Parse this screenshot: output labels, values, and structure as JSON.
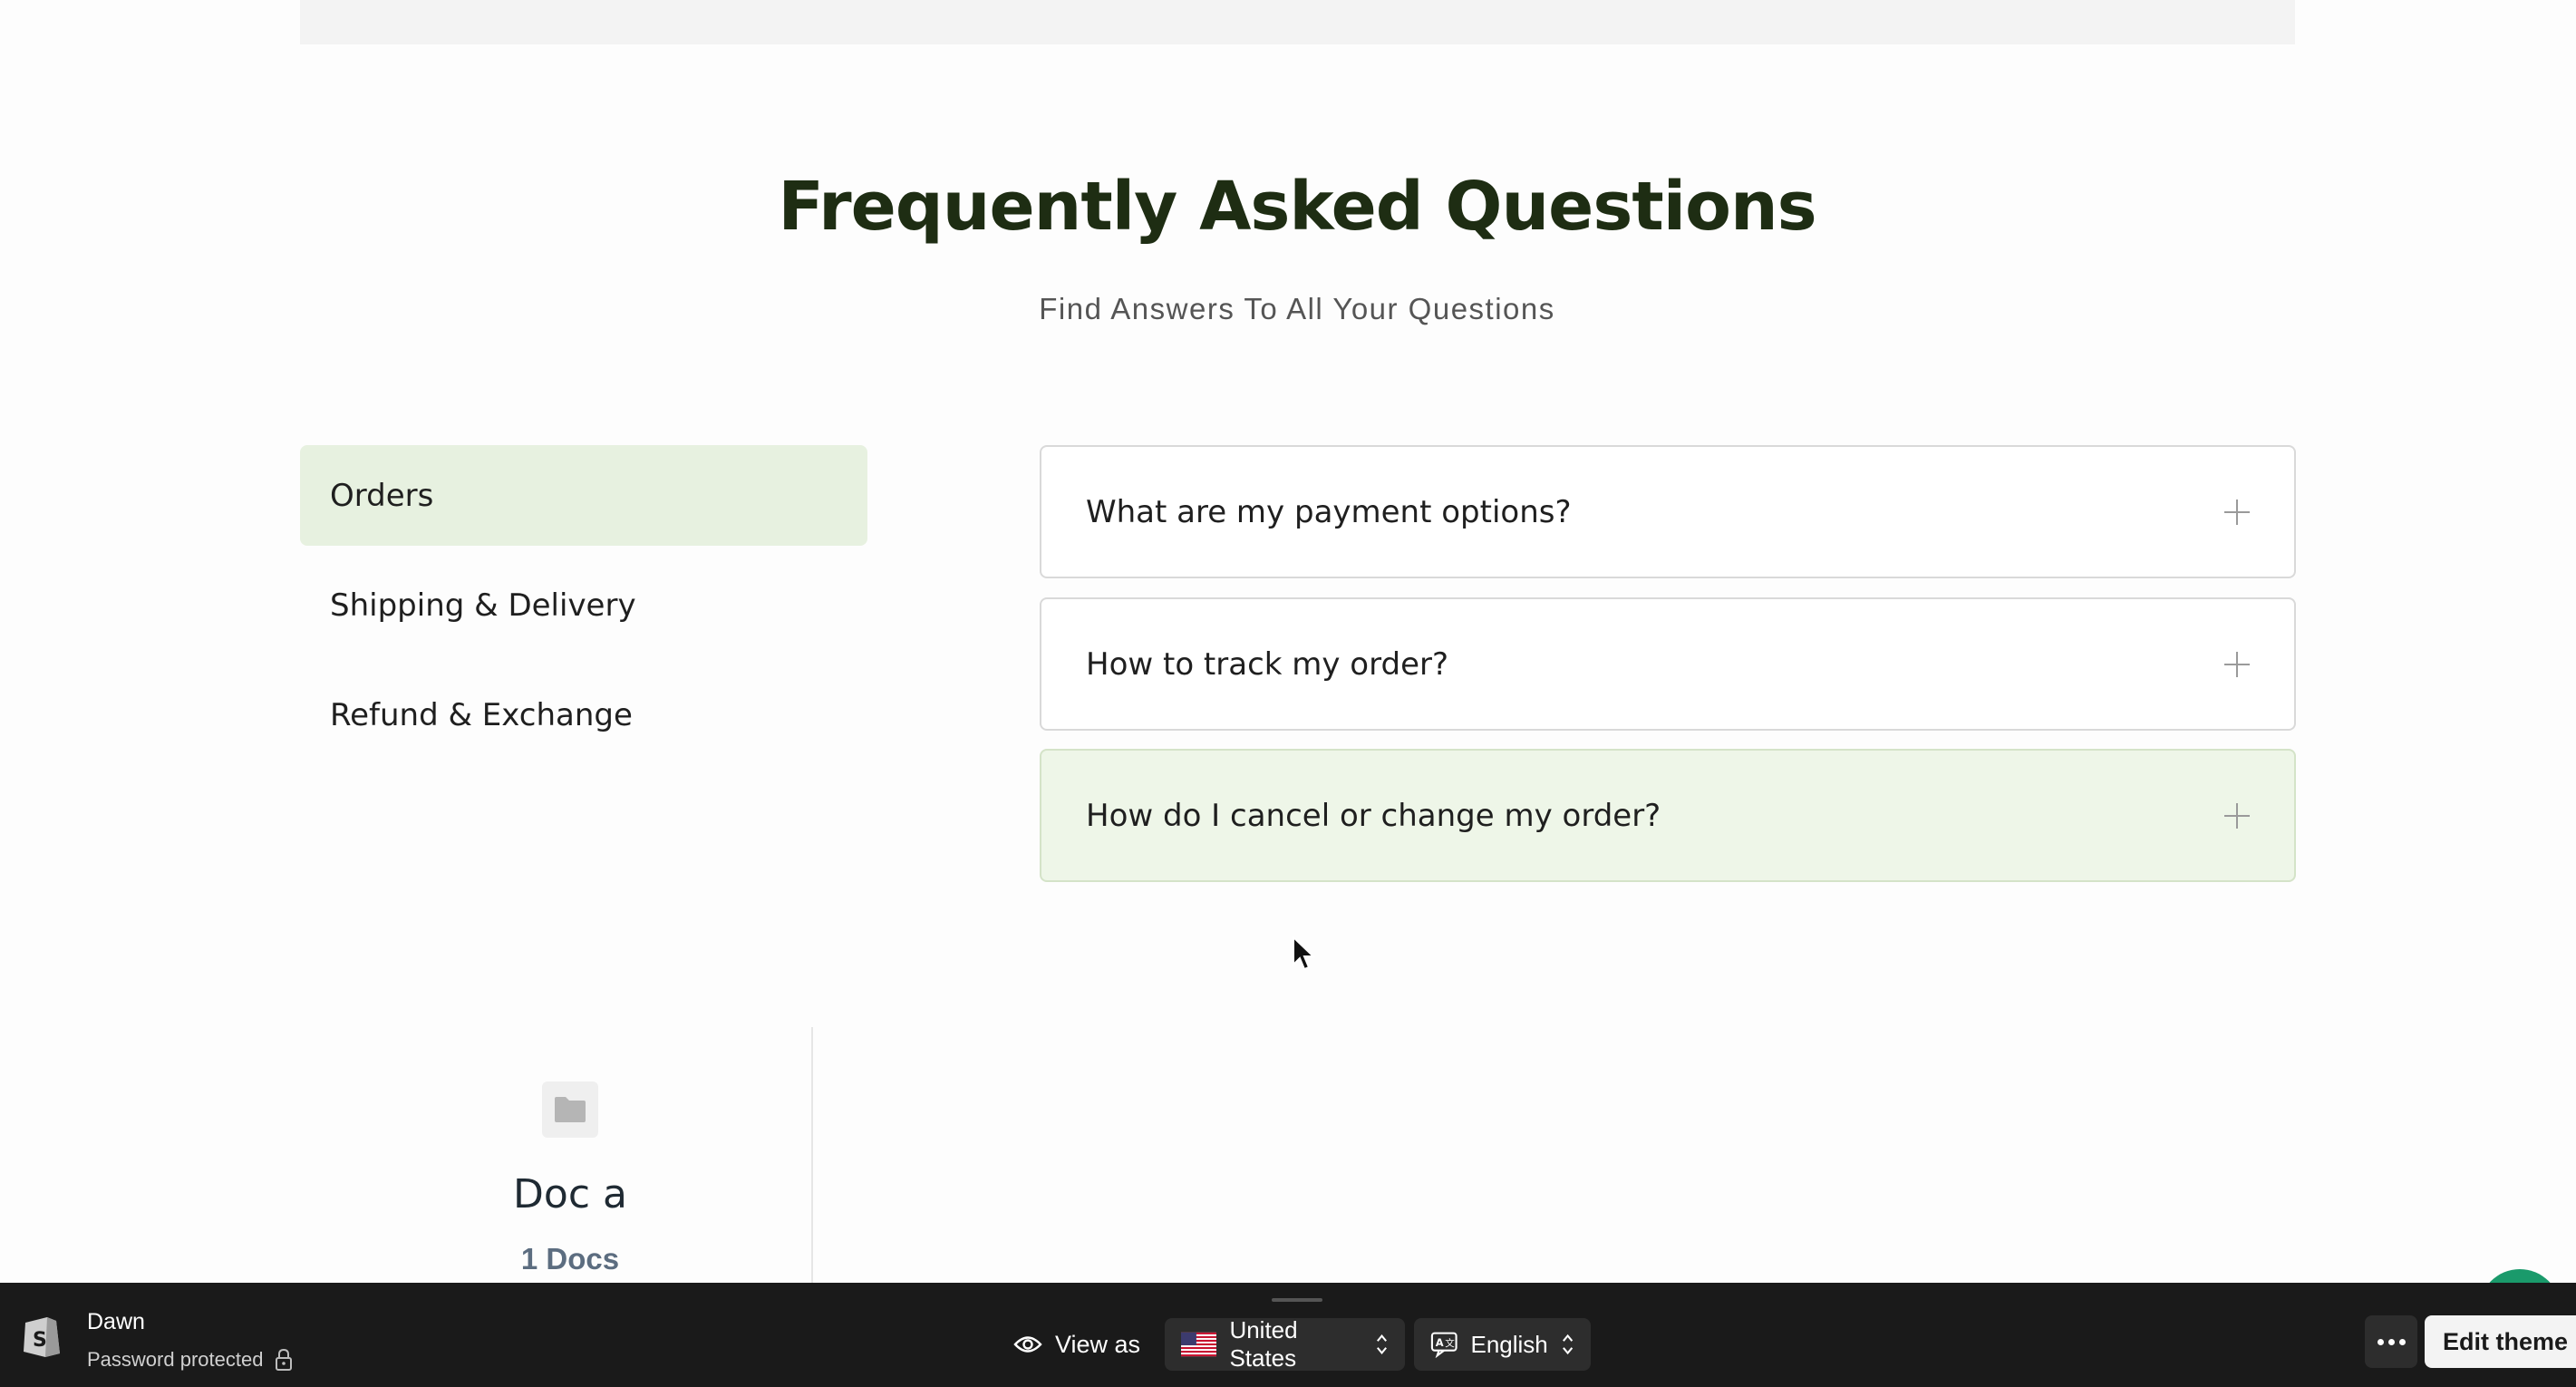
{
  "faq": {
    "title": "Frequently Asked Questions",
    "subtitle": "Find Answers To All Your Questions",
    "categories": [
      {
        "label": "Orders",
        "active": true
      },
      {
        "label": "Shipping & Delivery",
        "active": false
      },
      {
        "label": "Refund & Exchange",
        "active": false
      }
    ],
    "questions": [
      {
        "label": "What are my payment options?"
      },
      {
        "label": "How to track my order?"
      },
      {
        "label": "How do I cancel or change my order?"
      }
    ]
  },
  "docs": {
    "name": "Doc a",
    "count": "1 Docs",
    "icon": "folder-icon"
  },
  "preview_bar": {
    "store_name": "Dawn",
    "store_status": "Password protected",
    "view_as_label": "View as",
    "country": "United States",
    "language": "English",
    "edit_theme_label": "Edit theme"
  },
  "colors": {
    "title": "#1e2d13",
    "active_category_bg": "#e7f1e0",
    "active_question_bg": "#eef6e8",
    "bar_bg": "#1a1a1a",
    "chat_bubble": "#1a9a6b"
  }
}
